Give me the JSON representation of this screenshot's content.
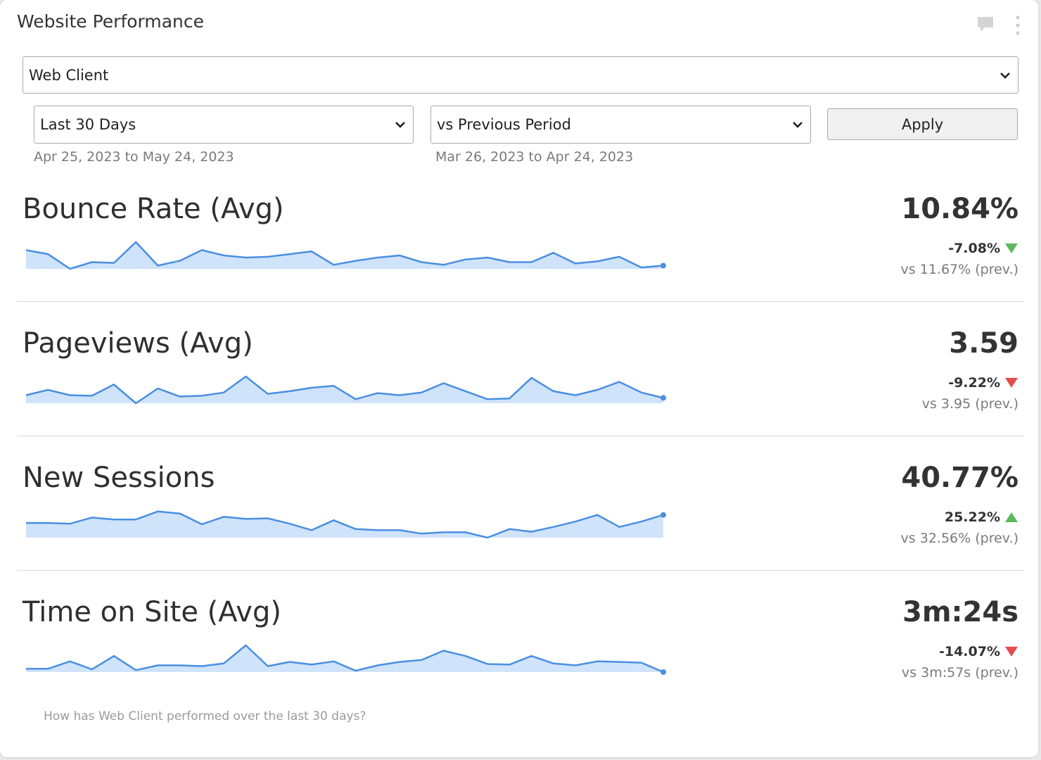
{
  "widget": {
    "title": "Website Performance"
  },
  "icons": {
    "comment": "comment-icon",
    "more": "more-vertical-icon",
    "chevron": "chevron-down-icon"
  },
  "filters": {
    "client": "Web Client",
    "range": "Last 30 Days",
    "compare": "vs Previous Period",
    "apply_label": "Apply",
    "range_dates": {
      "start": "Apr 25, 2023",
      "sep": "to",
      "end": "May 24, 2023"
    },
    "compare_dates": {
      "start": "Mar 26, 2023",
      "sep": "to",
      "end": "Apr 24, 2023"
    }
  },
  "colors": {
    "line": "#4a8fe0",
    "fill": "#cfe3fb",
    "down_good": "#5cb85c",
    "down_bad": "#e24c4b",
    "up_good": "#5cb85c"
  },
  "metrics": [
    {
      "name": "Bounce Rate (Avg)",
      "value": "10.84%",
      "change": "-7.08%",
      "direction": "down",
      "trend_color": "#5cb85c",
      "prev": "vs 11.67% (prev.)"
    },
    {
      "name": "Pageviews (Avg)",
      "value": "3.59",
      "change": "-9.22%",
      "direction": "down",
      "trend_color": "#e24c4b",
      "prev": "vs 3.95 (prev.)"
    },
    {
      "name": "New Sessions",
      "value": "40.77%",
      "change": "25.22%",
      "direction": "up",
      "trend_color": "#5cb85c",
      "prev": "vs 32.56% (prev.)"
    },
    {
      "name": "Time on Site (Avg)",
      "value": "3m:24s",
      "change": "-14.07%",
      "direction": "down",
      "trend_color": "#e24c4b",
      "prev": "vs 3m:57s (prev.)"
    }
  ],
  "chart_data": [
    {
      "type": "area",
      "series": [
        {
          "values": [
            0.7,
            0.55,
            0.0,
            0.25,
            0.22,
            1.0,
            0.12,
            0.3,
            0.7,
            0.5,
            0.42,
            0.45,
            0.55,
            0.65,
            0.15,
            0.3,
            0.42,
            0.5,
            0.25,
            0.15,
            0.35,
            0.42,
            0.25,
            0.25,
            0.6,
            0.2,
            0.28,
            0.45,
            0.05,
            0.12
          ]
        }
      ]
    },
    {
      "type": "area",
      "series": [
        {
          "values": [
            0.3,
            0.5,
            0.3,
            0.28,
            0.7,
            0.0,
            0.55,
            0.25,
            0.28,
            0.4,
            1.0,
            0.35,
            0.45,
            0.58,
            0.65,
            0.15,
            0.38,
            0.3,
            0.4,
            0.75,
            0.45,
            0.15,
            0.18,
            0.95,
            0.45,
            0.3,
            0.5,
            0.8,
            0.4,
            0.2
          ]
        }
      ]
    },
    {
      "type": "area",
      "series": [
        {
          "values": [
            0.55,
            0.55,
            0.52,
            0.75,
            0.68,
            0.68,
            0.98,
            0.9,
            0.5,
            0.78,
            0.7,
            0.72,
            0.52,
            0.28,
            0.65,
            0.32,
            0.28,
            0.28,
            0.15,
            0.2,
            0.2,
            0.0,
            0.32,
            0.22,
            0.4,
            0.6,
            0.85,
            0.4,
            0.6,
            0.85
          ]
        }
      ]
    },
    {
      "type": "area",
      "series": [
        {
          "values": [
            0.12,
            0.12,
            0.4,
            0.1,
            0.6,
            0.07,
            0.25,
            0.25,
            0.22,
            0.32,
            1.0,
            0.22,
            0.38,
            0.28,
            0.4,
            0.05,
            0.25,
            0.38,
            0.45,
            0.8,
            0.6,
            0.3,
            0.28,
            0.6,
            0.32,
            0.25,
            0.4,
            0.38,
            0.35,
            0.0
          ]
        }
      ]
    }
  ],
  "footnote": "How has Web Client performed over the last 30 days?"
}
